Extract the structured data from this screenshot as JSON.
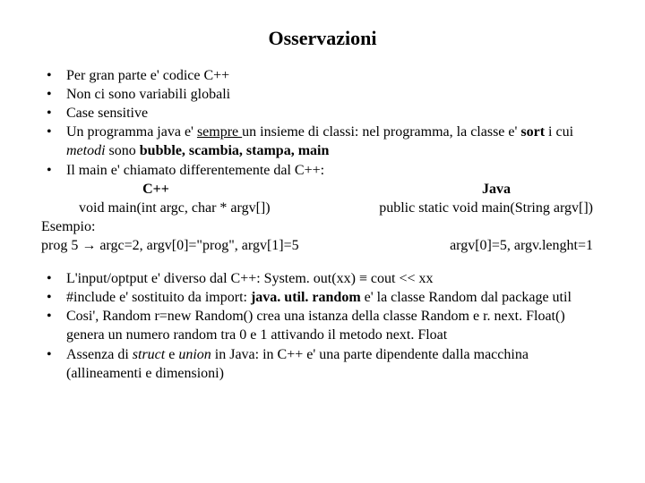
{
  "title": "Osservazioni",
  "b1": {
    "i0": "Per gran parte e' codice C++",
    "i1": "Non ci sono variabili globali",
    "i2": "Case sensitive",
    "i3a": "Un programma java e' ",
    "i3u": "sempre ",
    "i3b": " un insieme di classi: nel programma, la classe e' ",
    "i3c": "sort",
    "i3d": " i cui ",
    "i3e": "metodi",
    "i3f": " sono ",
    "i3g": "bubble, scambia, stampa, main",
    "i4": "Il main e' chiamato differentemente dal C++:"
  },
  "head": {
    "l": "C++",
    "r": "Java"
  },
  "sig": {
    "l": "void main(int argc, char * argv[])",
    "r": "public static void main(String argv[])"
  },
  "ex": {
    "l0": "Esempio:",
    "l1a": "prog 5 ",
    "l1arrow": "→",
    "l1b": " argc=2, argv[0]=\"prog\", argv[1]=5",
    "r1": "argv[0]=5, argv.lenght=1"
  },
  "b2": {
    "i0": "L'input/optput e' diverso dal C++:   System. out(xx)  ≡   cout << xx",
    "i1a": "#include e' sostituito da import:  ",
    "i1b": "java. util. random",
    "i1c": " e' la classe Random dal package util",
    "i2": "Cosi',  Random r=new Random() crea una istanza della classe Random e r. next. Float() genera un numero random tra 0 e 1 attivando il metodo next. Float",
    "i3a": "Assenza di ",
    "i3b": "struct",
    "i3c": " e ",
    "i3d": "union",
    "i3e": " in Java: in C++ e' una parte dipendente dalla macchina (allineamenti e dimensioni)"
  }
}
